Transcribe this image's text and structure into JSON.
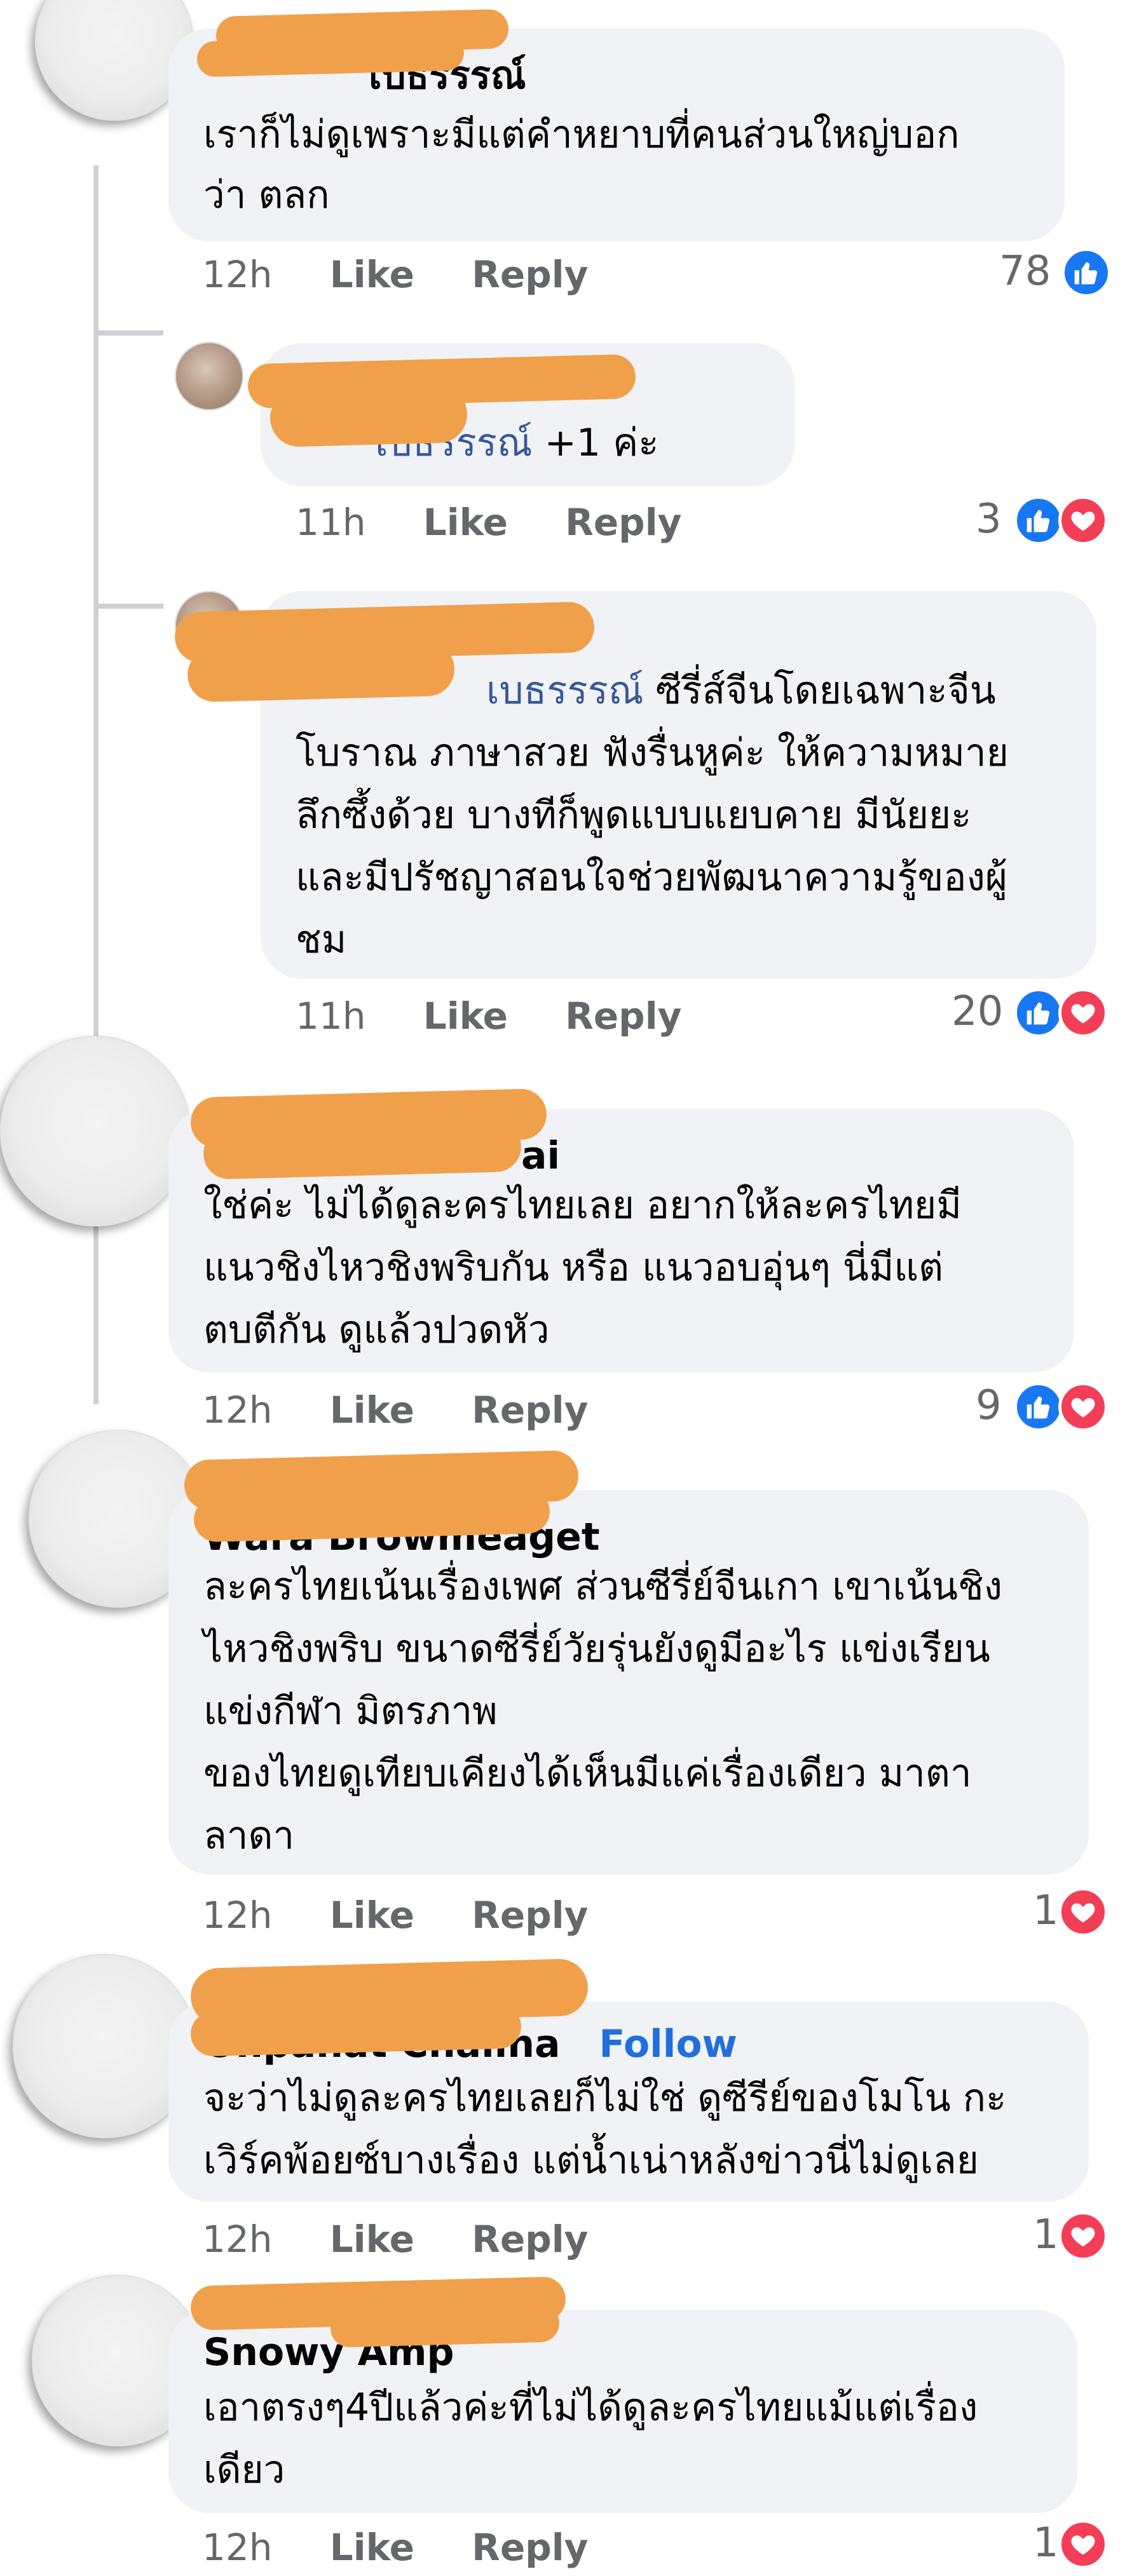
{
  "actions": {
    "like": "Like",
    "reply": "Reply"
  },
  "comments": [
    {
      "name_tail": "เบธรรรณ์",
      "lines": [
        "เราก็ไม่ดูเพราะมีแต่คำหยาบที่คนส่วนใหญ่บอก",
        "ว่า ตลก"
      ],
      "time": "12h",
      "count": "78",
      "reactions": [
        "like-icon"
      ]
    },
    {
      "mention_tail": "เบธรรรณ์",
      "text_after_mention": " +1 ค่ะ",
      "time": "11h",
      "count": "3",
      "reactions": [
        "like-icon",
        "love-icon"
      ]
    },
    {
      "mention_tail": "เบธรรรณ์",
      "lines": [
        "ซีรี่ส์จีนโดยเฉพาะจีน",
        "โบราณ ภาษาสวย ฟังรื่นหูค่ะ ให้ความหมาย",
        "ลึกซึ้งด้วย บางทีก็พูดแบบแยบคาย มีนัยยะ",
        "และมีปรัชญาสอนใจช่วยพัฒนาความรู้ของผู้",
        "ชม"
      ],
      "time": "11h",
      "count": "20",
      "reactions": [
        "like-icon",
        "love-icon"
      ]
    },
    {
      "name_tail": "ai",
      "lines": [
        "ใช่ค่ะ ไม่ได้ดูละครไทยเลย  อยากให้ละครไทยมี",
        "แนวชิงไหวชิงพริบกัน หรือ แนวอบอุ่นๆ  นี่มีแต่",
        "ตบตีกัน ดูแล้วปวดหัว"
      ],
      "time": "12h",
      "count": "9",
      "reactions": [
        "like-icon",
        "love-icon"
      ]
    },
    {
      "name_tail": "Wara Browmeaget",
      "lines": [
        "ละครไทยเน้นเรื่องเพศ ส่วนซีรี่ย์จีนเกา เขาเน้นชิง",
        "ไหวชิงพริบ ขนาดซีรี่ย์วัยรุ่นยังดูมีอะไร แข่งเรียน",
        "แข่งกีฬา มิตรภาพ",
        "ของไทยดูเทียบเคียงได้เห็นมีแค่เรื่องเดียว มาตา",
        "ลาดา"
      ],
      "time": "12h",
      "count": "1",
      "reactions": [
        "love-icon"
      ]
    },
    {
      "name_tail": "Onpanat Chalina",
      "follow": "Follow",
      "lines": [
        "จะว่าไม่ดูละครไทยเลยก็ไม่ใช่ ดูซีรีย์ของโมโน กะ",
        "เวิร์คพ้อยซ์บางเรื่อง แต่น้ำเน่าหลังข่าวนี่ไม่ดูเลย"
      ],
      "time": "12h",
      "count": "1",
      "reactions": [
        "love-icon"
      ]
    },
    {
      "name_tail": "Snowy Amp",
      "lines": [
        "เอาตรงๆ4ปีแล้วค่ะที่ไม่ได้ดูละครไทยแม้แต่เรื่อง",
        "เดียว"
      ],
      "time": "12h",
      "count": "1",
      "reactions": [
        "love-icon"
      ]
    }
  ],
  "colors": {
    "like": "#1877f2",
    "love": "#f33e58",
    "bubble": "#f0f2f5",
    "meta": "#65676b",
    "mention": "#385898",
    "redaction": "#f0a04b"
  }
}
